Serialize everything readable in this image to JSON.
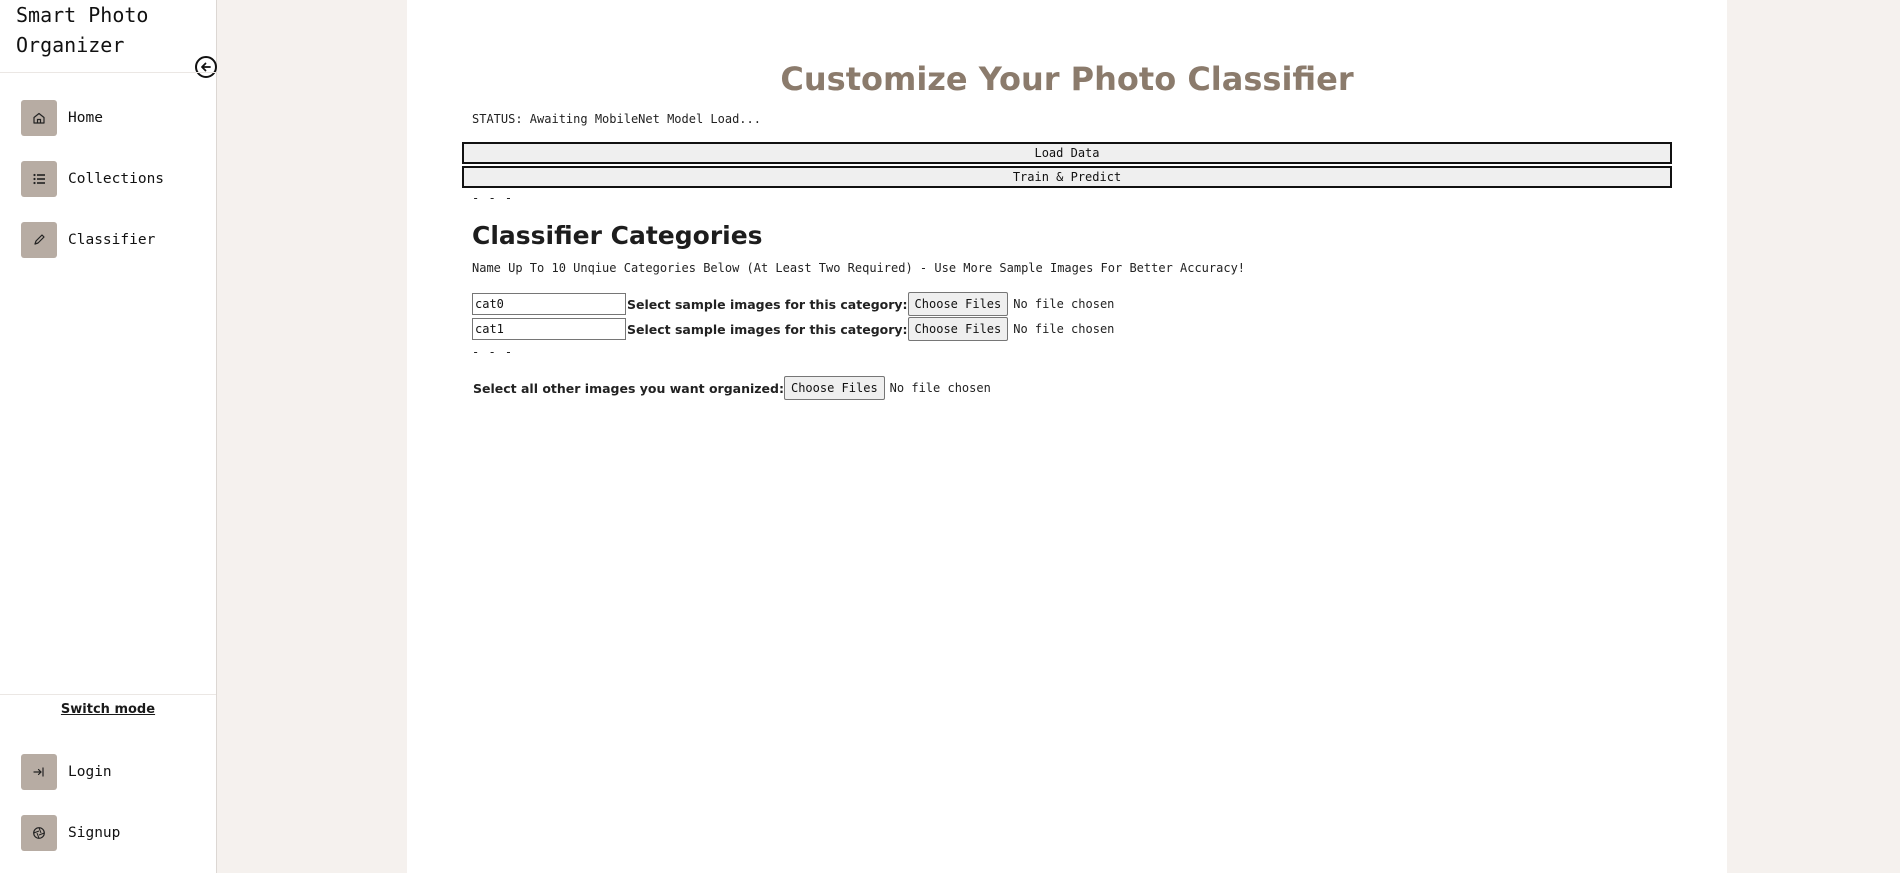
{
  "sidebar": {
    "brand_line1": "Smart Photo",
    "brand_line2": "Organizer",
    "collapse_icon": "arrow-left-circle-icon",
    "nav": [
      {
        "label": "Home",
        "icon": "home-icon"
      },
      {
        "label": "Collections",
        "icon": "list-icon"
      },
      {
        "label": "Classifier",
        "icon": "pencil-icon"
      }
    ],
    "switch_mode": "Switch mode",
    "auth": [
      {
        "label": "Login",
        "icon": "login-icon"
      },
      {
        "label": "Signup",
        "icon": "aperture-icon"
      }
    ]
  },
  "main": {
    "title": "Customize Your Photo Classifier",
    "status": "STATUS: Awaiting MobileNet Model Load...",
    "load_button": "Load Data",
    "train_button": "Train & Predict",
    "separator": "- - -",
    "categories_title": "Classifier Categories",
    "instructions": "Name Up To 10 Unqiue Categories Below (At Least Two Required) - Use More Sample Images For Better Accuracy!",
    "categories": [
      {
        "name": "cat0",
        "label": "Select sample images for this category:",
        "button": "Choose Files",
        "file_status": "No file chosen"
      },
      {
        "name": "cat1",
        "label": "Select sample images for this category:",
        "button": "Choose Files",
        "file_status": "No file chosen"
      }
    ],
    "other_label": "Select all other images you want organized:",
    "other_button": "Choose Files",
    "other_file_status": "No file chosen"
  },
  "colors": {
    "page_background": "#f5f1ee",
    "title_color": "#8b7b6c",
    "nav_icon_background": "#b7aca3"
  }
}
